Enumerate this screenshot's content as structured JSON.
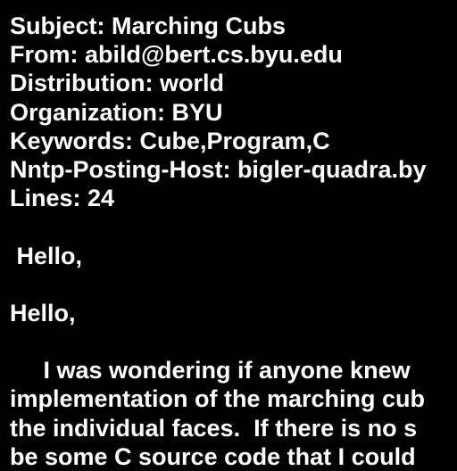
{
  "message": {
    "headers": [
      "Subject: Marching Cubs",
      "From: abild@bert.cs.byu.edu",
      "Distribution: world",
      "Organization: BYU",
      "Keywords: Cube,Program,C",
      "Nntp-Posting-Host: bigler-quadra.by",
      "Lines: 24"
    ],
    "body": [
      "",
      " Hello,",
      "",
      "Hello,",
      "",
      "     I was wondering if anyone knew",
      "implementation of the marching cub",
      "the individual faces.  If there is no s",
      "be some C source code that I could"
    ]
  },
  "colors": {
    "background": "#000000",
    "text": "#ffffff"
  }
}
